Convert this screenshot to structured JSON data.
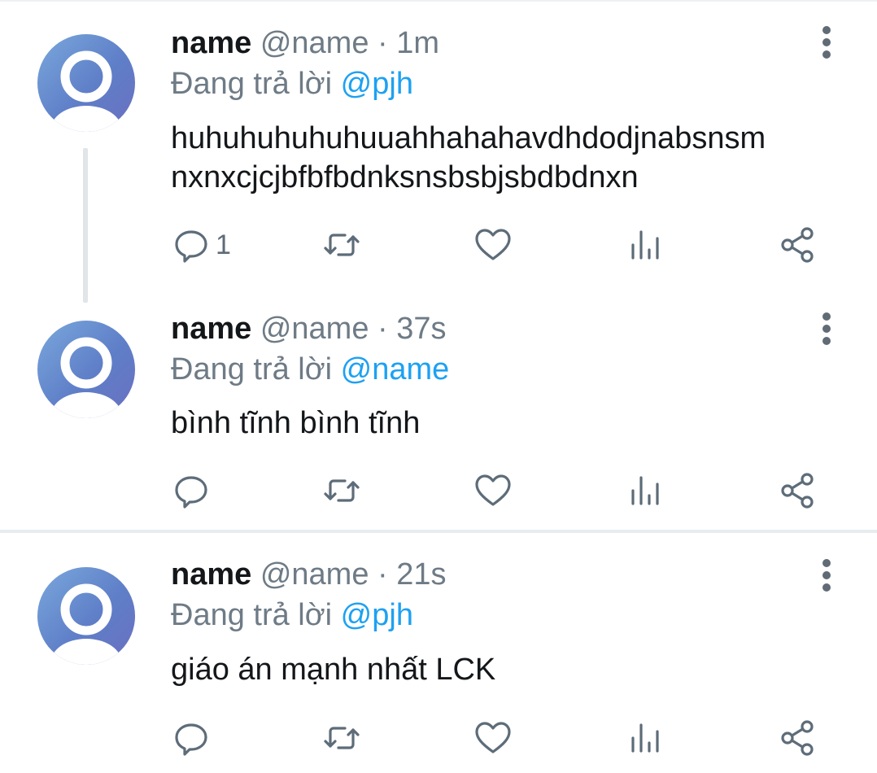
{
  "tweets": [
    {
      "username": "name",
      "handle": "@name",
      "separator": "·",
      "time": "1m",
      "replying_prefix": "Đang trả lời",
      "replying_to": "@pjh",
      "text_line1": "huhuhuhuhuhuuahhahahavdhdodjnabsnsm",
      "text_line2": "nxnxcjcjbfbfbdnksnsbsbjsbdbdnxn",
      "reply_count": "1",
      "icons": [
        "reply-icon",
        "retweet-icon",
        "like-icon",
        "stats-icon",
        "share-icon",
        "more-icon"
      ]
    },
    {
      "username": "name",
      "handle": "@name",
      "separator": "·",
      "time": "37s",
      "replying_prefix": "Đang trả lời",
      "replying_to": "@name",
      "text_line1": "bình tĩnh bình tĩnh",
      "reply_count": ""
    },
    {
      "username": "name",
      "handle": "@name",
      "separator": "·",
      "time": "21s",
      "replying_prefix": "Đang trả lời",
      "replying_to": "@pjh",
      "text_line1": "giáo án mạnh nhất LCK",
      "reply_count": ""
    }
  ],
  "colors": {
    "text": "#14171a",
    "secondary": "#6e7b86",
    "mention": "#1da1f2",
    "icon": "#5d6c79",
    "divider": "#e6ecf0"
  }
}
